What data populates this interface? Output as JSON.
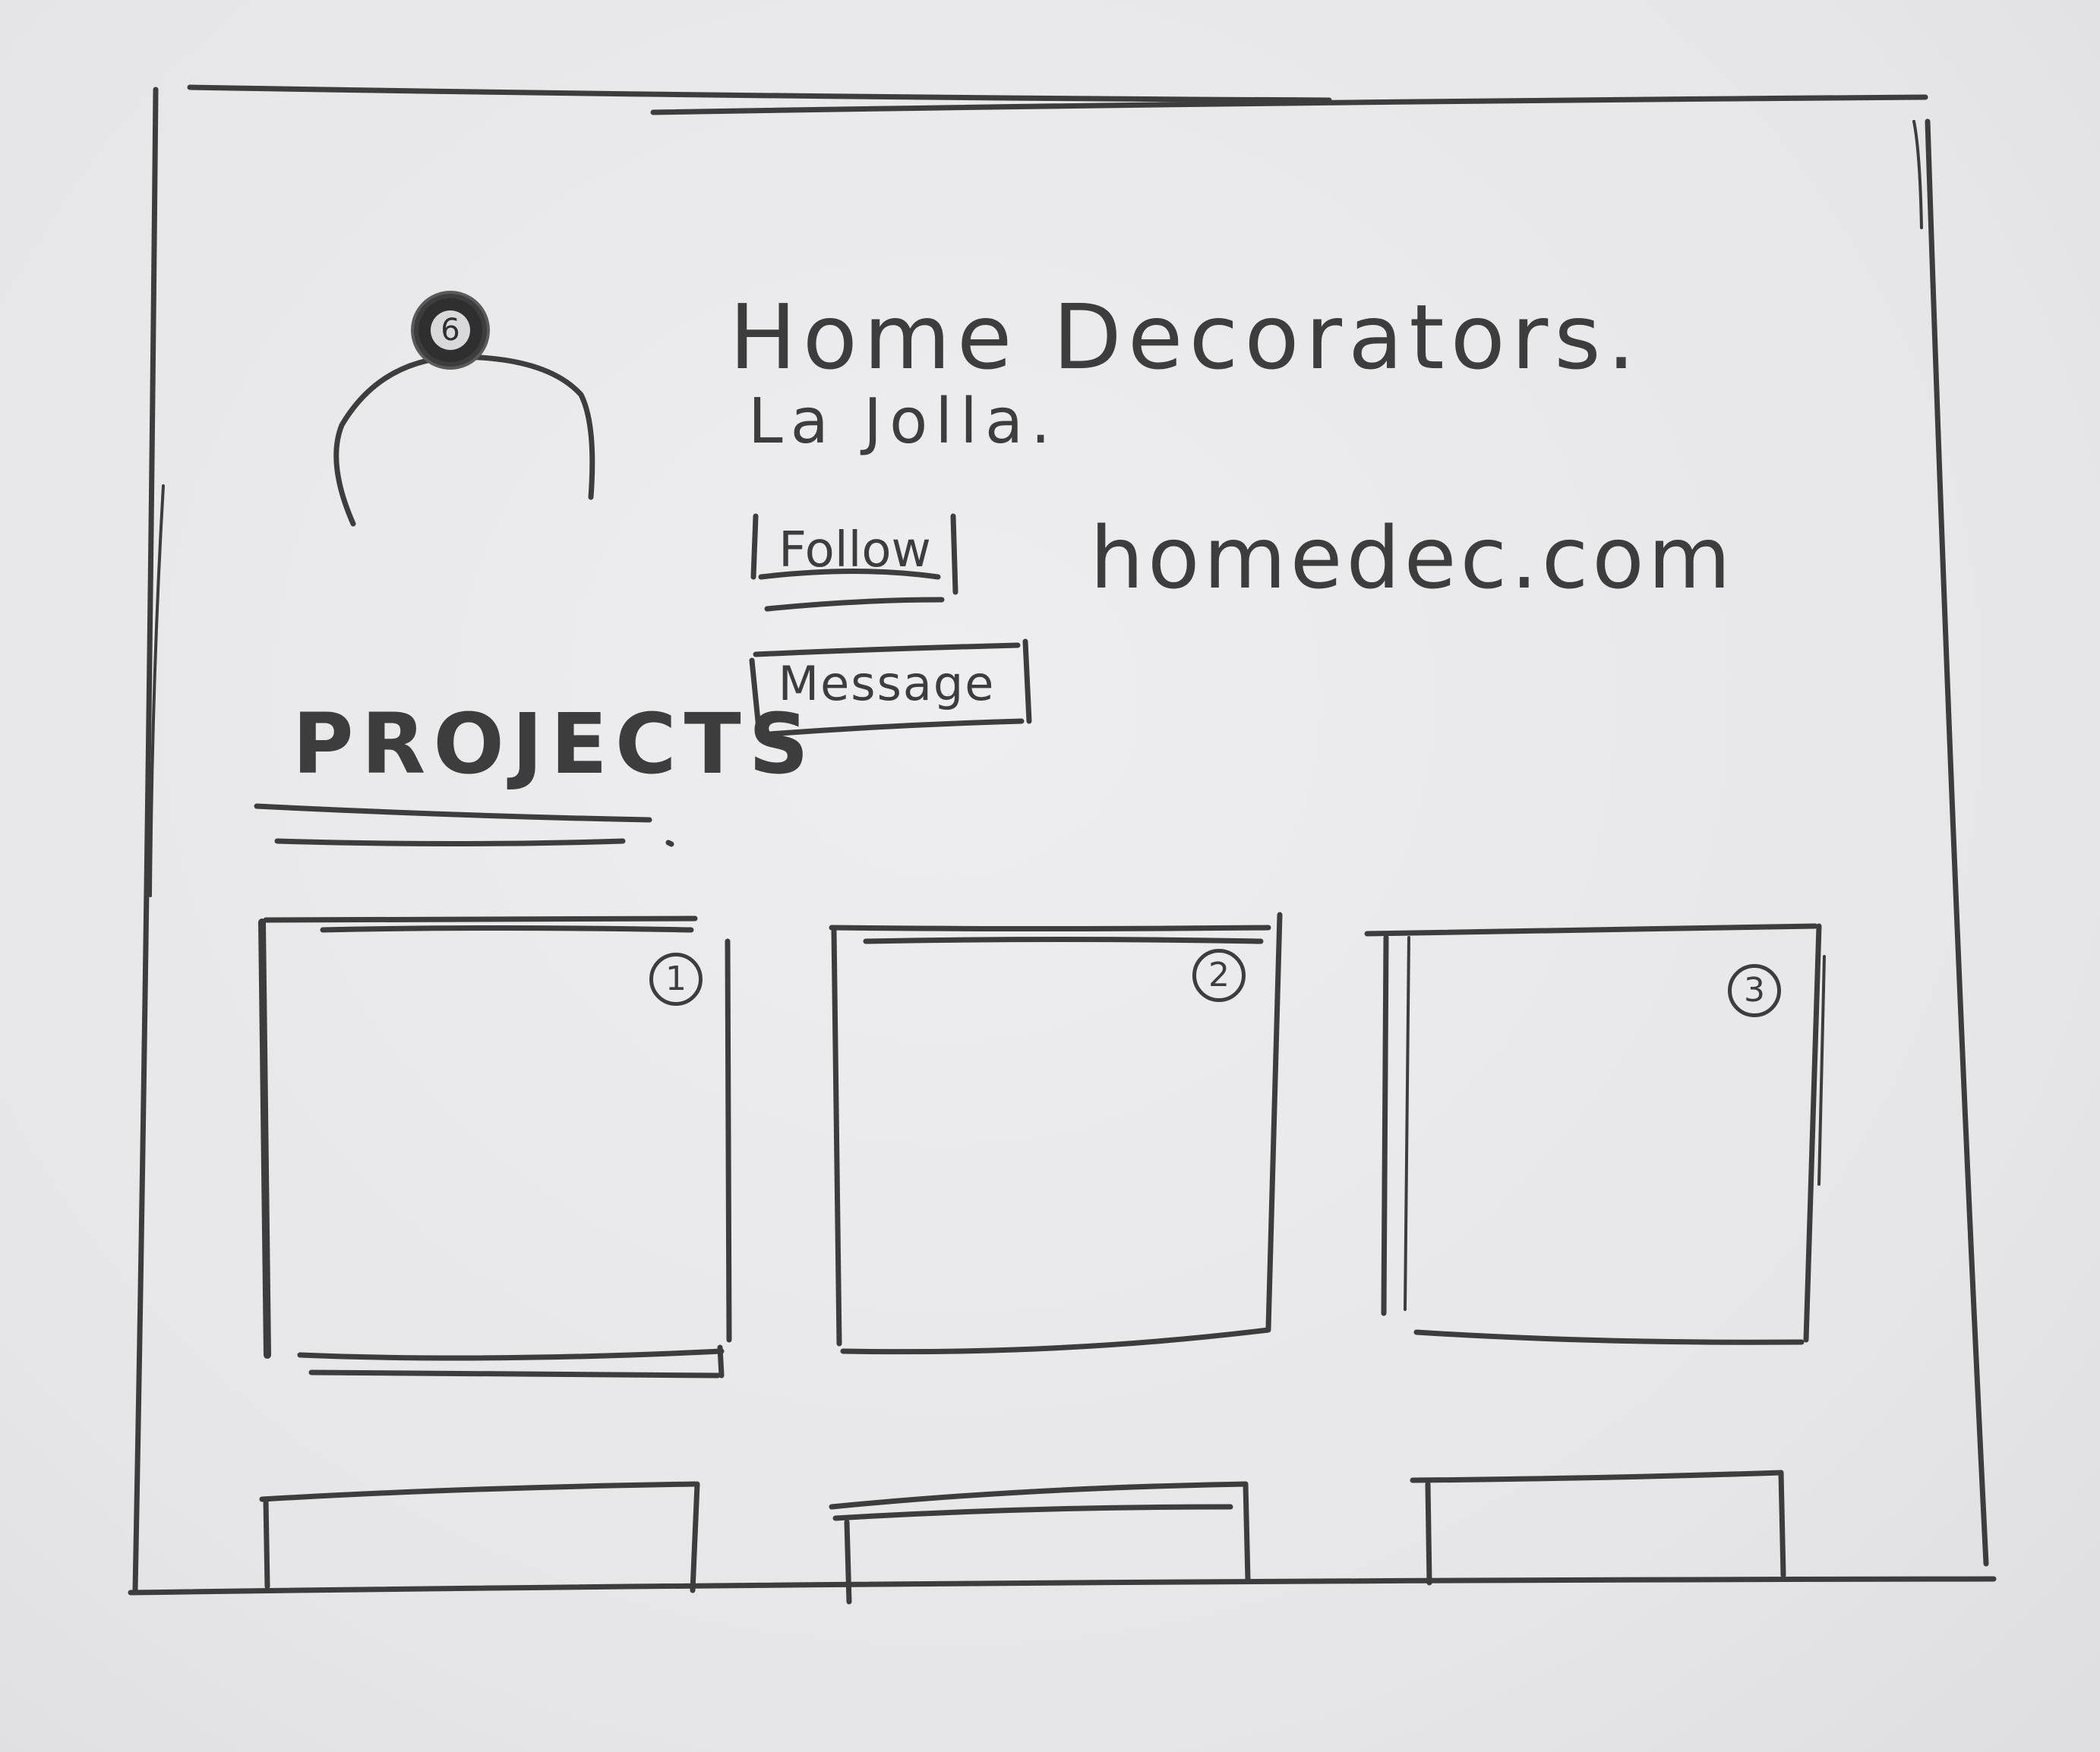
{
  "profile": {
    "name": "Home Decorators.",
    "location": "La Jolla.",
    "website": "homedec.com"
  },
  "actions": {
    "follow_label": "Follow",
    "message_label": "Message"
  },
  "projects": {
    "heading": "PROJECTS",
    "items": [
      {
        "number": "1"
      },
      {
        "number": "2"
      },
      {
        "number": "3"
      }
    ]
  },
  "avatar": {
    "notification_count": "6"
  },
  "colors": {
    "paper": "#e9e9eb",
    "pencil": "#3d3d3d"
  }
}
